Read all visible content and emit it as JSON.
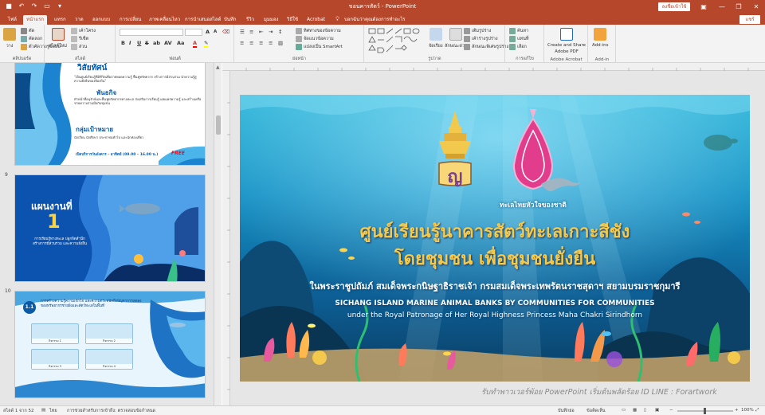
{
  "titlebar": {
    "doc_title": "ขอนคารสัตว์ - PowerPoint",
    "signin": "ลงชื่อเข้าใช้",
    "minimize": "—",
    "restore": "❐",
    "close": "✕"
  },
  "tabs": [
    {
      "label": "ไฟล์"
    },
    {
      "label": "หน้าแรก",
      "active": true
    },
    {
      "label": "แทรก"
    },
    {
      "label": "วาด"
    },
    {
      "label": "ออกแบบ"
    },
    {
      "label": "การเปลี่ยน"
    },
    {
      "label": "ภาพเคลื่อนไหว"
    },
    {
      "label": "การนำเสนอสไลด์"
    },
    {
      "label": "บันทึก"
    },
    {
      "label": "รีวิว"
    },
    {
      "label": "มุมมอง"
    },
    {
      "label": "วิธีใช้"
    },
    {
      "label": "Acrobat"
    }
  ],
  "tell_me": "บอกฉันว่าคุณต้องการทำอะไร",
  "share": "แชร์",
  "ribbon": {
    "clipboard": {
      "label": "คลิปบอร์ด",
      "paste": "วาง",
      "cut": "ตัด",
      "copy": "คัดลอก",
      "format_painter": "ตัวคัดวางรูปแบบ"
    },
    "slides": {
      "label": "สไลด์",
      "new_slide": "สไลด์ใหม่",
      "layout": "เค้าโครง",
      "reset": "รีเซ็ต",
      "section": "ส่วน"
    },
    "font": {
      "label": "ฟอนต์",
      "bold": "B",
      "italic": "I",
      "underline": "U",
      "strike": "S",
      "shadow": "ab",
      "spacing": "AV",
      "case": "Aa",
      "grow": "A",
      "shrink": "A"
    },
    "paragraph": {
      "label": "ย่อหน้า",
      "text_direction": "ทิศทางของข้อความ",
      "align_text": "จัดแนวข้อความ",
      "smartart": "แปลงเป็น SmartArt"
    },
    "drawing": {
      "label": "รูปวาด",
      "arrange": "จัดเรียง",
      "quick_styles": "ลักษณะด่วน",
      "fill": "เติมรูปร่าง",
      "outline": "เค้าร่างรูปร่าง",
      "effects": "ลักษณะพิเศษรูปร่าง"
    },
    "editing": {
      "label": "การแก้ไข",
      "find": "ค้นหา",
      "replace": "แทนที่",
      "select": "เลือก"
    },
    "acrobat": {
      "label": "Adobe Acrobat",
      "create_share": "Create and Share",
      "adobe_pdf": "Adobe PDF"
    },
    "addins": {
      "label": "Add-in",
      "addins": "Add-ins"
    }
  },
  "slides_panel": {
    "thumb1": {
      "title": "วิสัยทัศน์",
      "vision_text": "\"เป็นศูนย์เรียนรู้ที่มีชีวิตเพื่อถ่ายทอดความรู้ ฟื้นฟูทรัพยากร สร้างการมีส่วนร่วม นำความรู้สู่ความยั่งยืนของท้องถิ่น\"",
      "mission_head": "พันธกิจ",
      "mission_text": "ทำหน้าที่อนุรักษ์และฟื้นฟูทรัพยากรทางทะเล ส่งเสริมการเรียนรู้ เผยแพร่ความรู้ และสร้างเครือข่ายความร่วมมือกับชุมชน",
      "target_head": "กลุ่มเป้าหมาย",
      "target_text": "นักเรียน นักศึกษา ประชาชนทั่วไป และนักท่องเที่ยว",
      "time": "เปิดบริการวันอังคาร - อาทิตย์ (09.00 – 16.00 น.)",
      "free": "FREE"
    },
    "thumb2": {
      "number_label": "9",
      "title": "แผนงานที่",
      "number": "1",
      "text": "การเรียนรู้ทางทะเล ปลูกจิตสำนึก สร้างการมีส่วนร่วม และความยั่งยืน"
    },
    "thumb3": {
      "number_label": "10",
      "badge": "1.1",
      "text": "การสร้างความรู้ความเข้าใจ และความตระหนักถึงปัญหาการลดลงของทรัพยากรชายฝั่งและสัตว์ทะเลในพื้นที่",
      "cards": [
        "กิจกรรม 1",
        "กิจกรรม 2",
        "กิจกรรม 3",
        "กิจกรรม 4"
      ]
    }
  },
  "main_slide": {
    "tagline": "ทะเลไทยหัวใจของชาติ",
    "title_line1": "ศูนย์เรียนรู้นาคารสัตว์ทะเลเกาะสีชัง",
    "title_line2": "โดยชุมชน เพื่อชุมชนยั่งยืน",
    "subtitle_th": "ในพระราชูปถัมภ์ สมเด็จพระกนิษฐาธิราชเจ้า กรมสมเด็จพระเทพรัตนราชสุดาฯ สยามบรมราชกุมารี",
    "subtitle_en1": "SICHANG ISLAND MARINE ANIMAL BANKS BY COMMUNITIES FOR COMMUNITIES",
    "subtitle_en2": "under the Royal Patronage of Her Royal Highness Princess Maha Chakri Sirindhorn"
  },
  "watermark": "รับทำพาวเวอร์พ้อย PowerPoint เริ่มต้นพลัดร้อย ID LINE : Forartwork",
  "statusbar": {
    "slide_info": "สไลด์ 1 จาก 52",
    "language": "ไทย",
    "accessibility": "การช่วยสำหรับการเข้าถึง: ตรวจสอบข้อกำหนด",
    "notes": "บันทึกย่อ",
    "comments": "ข้อคิดเห็น",
    "zoom": "100%"
  },
  "colors": {
    "accent": "#b7472a",
    "title_gold": "#f7c948"
  }
}
